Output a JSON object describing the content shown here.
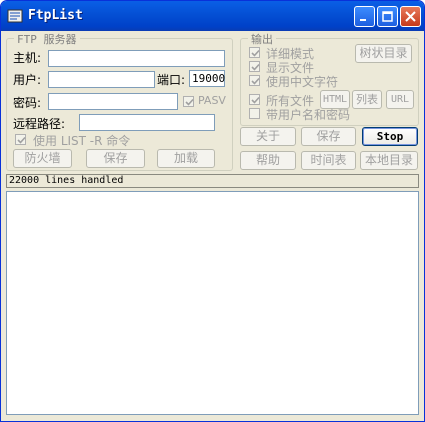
{
  "window": {
    "title": "FtpList"
  },
  "ftp_group": {
    "title": "FTP 服务器",
    "host_label": "主机:",
    "host_value": "",
    "user_label": "用户:",
    "user_value": "",
    "port_label": "端口:",
    "port_value": "19000",
    "password_label": "密码:",
    "password_value": "",
    "pasv_label": "PASV",
    "remote_path_label": "远程路径:",
    "remote_path_value": "",
    "list_r_label": "使用 LIST -R 命令",
    "firewall_button": "防火墙",
    "save_button": "保存",
    "load_button": "加载"
  },
  "output_group": {
    "title": "输出",
    "verbose_label": "详细模式",
    "show_files_label": "显示文件",
    "chinese_chars_label": "使用中文字符",
    "tree_dir_button": "树状目录",
    "all_files_label": "所有文件",
    "html_button": "HTML",
    "list_button": "列表",
    "url_button": "URL",
    "with_credentials_label": "带用户名和密码"
  },
  "actions": {
    "about_button": "关于",
    "save_button": "保存",
    "stop_button": "Stop",
    "help_button": "帮助",
    "timetable_button": "时间表",
    "local_dir_button": "本地目录"
  },
  "status": {
    "text": "22000 lines handled"
  }
}
